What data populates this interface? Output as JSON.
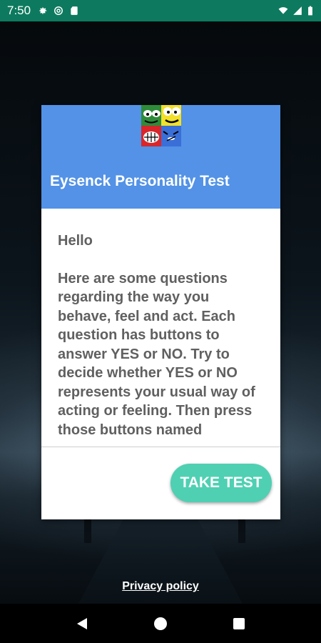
{
  "status_bar": {
    "time": "7:50",
    "left_icons": [
      "gear-icon",
      "at-sign-icon",
      "sd-card-icon"
    ],
    "right_icons": [
      "wifi-icon",
      "signal-icon",
      "battery-icon"
    ]
  },
  "dialog": {
    "logo_icon": "emoji-faces-logo-icon",
    "title": "Eysenck Personality Test",
    "greeting": "Hello",
    "body": "Here are some questions regarding the way you behave, feel and act. Each question has buttons to answer YES or NO. Try to decide whether YES or NO represents your usual way of acting or feeling. Then press those buttons named",
    "action_label": "TAKE TEST"
  },
  "footer": {
    "privacy_label": "Privacy policy"
  },
  "nav_bar": {
    "buttons": [
      "back-icon",
      "home-icon",
      "recents-icon"
    ]
  },
  "colors": {
    "status_bar": "#0d7a5f",
    "header": "#5392e6",
    "button": "#4fd0b2",
    "body_text": "#606060"
  }
}
